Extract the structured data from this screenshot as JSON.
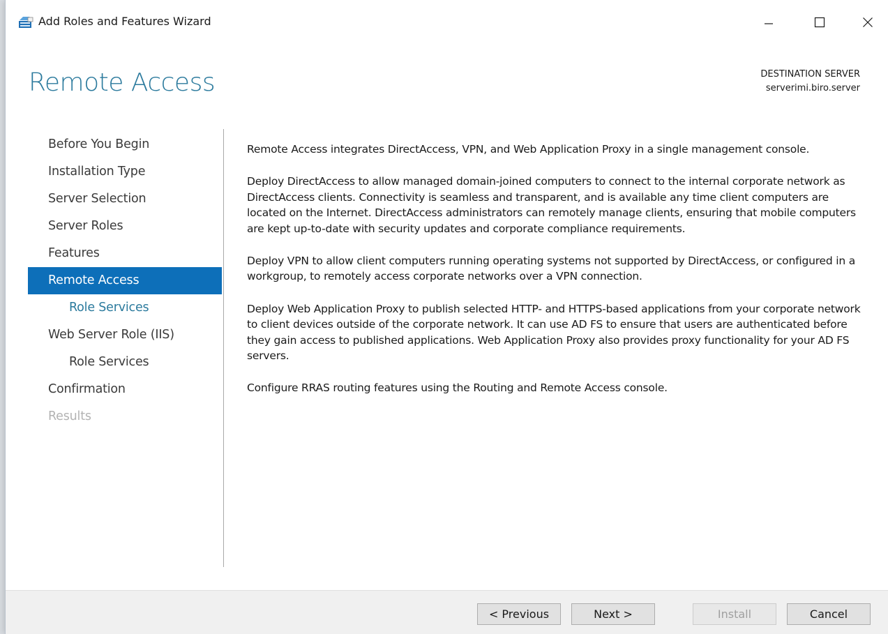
{
  "window": {
    "title": "Add Roles and Features Wizard"
  },
  "header": {
    "page_title": "Remote Access",
    "destination_label": "DESTINATION SERVER",
    "destination_server": "serverimi.biro.server"
  },
  "nav": {
    "items": [
      {
        "label": "Before You Begin",
        "state": "normal"
      },
      {
        "label": "Installation Type",
        "state": "normal"
      },
      {
        "label": "Server Selection",
        "state": "normal"
      },
      {
        "label": "Server Roles",
        "state": "normal"
      },
      {
        "label": "Features",
        "state": "normal"
      },
      {
        "label": "Remote Access",
        "state": "active"
      },
      {
        "label": "Role Services",
        "state": "link"
      },
      {
        "label": "Web Server Role (IIS)",
        "state": "normal"
      },
      {
        "label": "Role Services",
        "state": "normal"
      },
      {
        "label": "Confirmation",
        "state": "normal"
      },
      {
        "label": "Results",
        "state": "disabled"
      }
    ]
  },
  "content": {
    "paragraphs": [
      "Remote Access integrates DirectAccess, VPN, and Web Application Proxy in a single management console.",
      "Deploy DirectAccess to allow managed domain-joined computers to connect to the internal corporate network as DirectAccess clients. Connectivity is seamless and transparent, and is available any time client computers are located on the Internet. DirectAccess administrators can remotely manage clients, ensuring that mobile computers are kept up-to-date with security updates and corporate compliance requirements.",
      "Deploy VPN to allow client computers running operating systems not supported by DirectAccess, or configured in a workgroup, to remotely access corporate networks over a VPN connection.",
      "Deploy Web Application Proxy to publish selected HTTP- and HTTPS-based applications from your corporate network to client devices outside of the corporate network. It can use AD FS to ensure that users are authenticated before they gain access to published applications. Web Application Proxy also provides proxy functionality for your AD FS servers.",
      "Configure RRAS routing features using the Routing and Remote Access console."
    ]
  },
  "footer": {
    "previous_label": "< Previous",
    "next_label": "Next >",
    "install_label": "Install",
    "cancel_label": "Cancel"
  },
  "colors": {
    "accent": "#0d6fb9",
    "title": "#2b7a9d"
  },
  "icons": {
    "app": "server-manager-icon",
    "minimize": "minimize-icon",
    "maximize": "maximize-icon",
    "close": "close-icon"
  }
}
